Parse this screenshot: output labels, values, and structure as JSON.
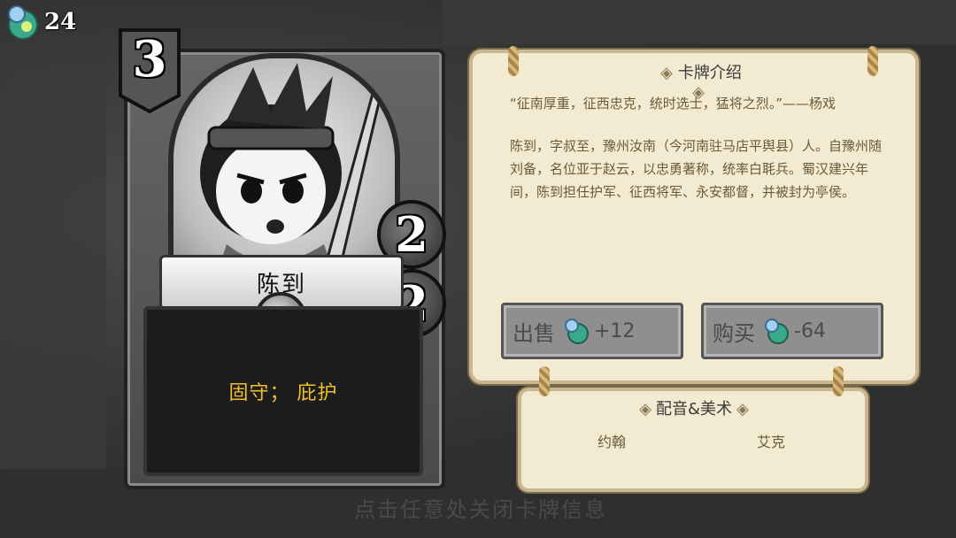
{
  "currency": {
    "icon": "gem-coin-icon",
    "amount": "24"
  },
  "card": {
    "cost": "3",
    "attack": "2",
    "health": "2",
    "name": "陈到",
    "keywords": "固守； 庇护"
  },
  "info_panel": {
    "title": "卡牌介绍",
    "quote": "“征南厚重，征西忠克，统时选士，猛将之烈。”——杨戏",
    "description": "陈到，字叔至，豫州汝南（今河南驻马店平舆县）人。自豫州随刘备，名位亚于赵云，以忠勇著称，统率白毦兵。蜀汉建兴年间，陈到担任护军、征西将军、永安都督，并被封为亭侯。",
    "sell": {
      "label": "出售",
      "amount": "+12"
    },
    "buy": {
      "label": "购买",
      "amount": "-64"
    }
  },
  "credits": {
    "title": "配音&美术",
    "voice": "约翰",
    "art": "艾克"
  },
  "background": {
    "hint": "点击任意处关闭卡牌信息"
  },
  "colors": {
    "keyword": "#f0c12c",
    "parchment": "#f3ead2",
    "button": "#8f8f8f"
  }
}
